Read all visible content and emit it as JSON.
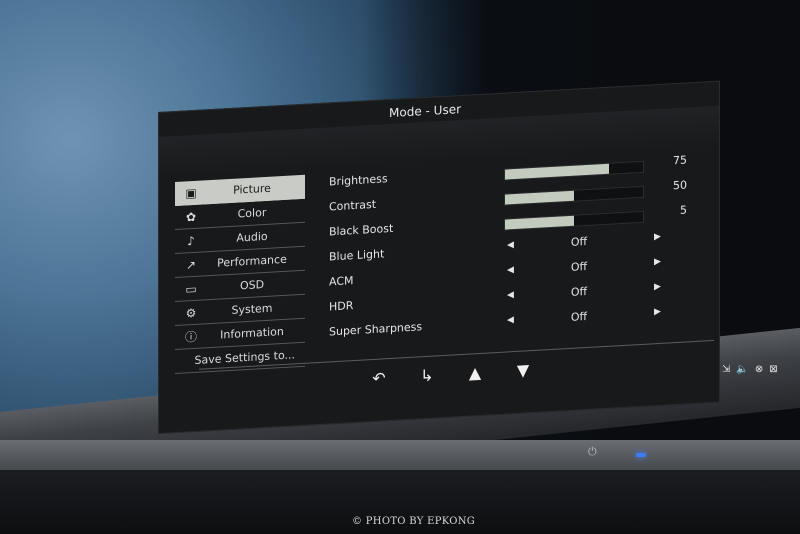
{
  "osd": {
    "title": "Mode - User",
    "menu": [
      {
        "label": "Picture",
        "icon": "picture-icon",
        "glyph": "▣",
        "active": true
      },
      {
        "label": "Color",
        "icon": "palette-icon",
        "glyph": "✿",
        "active": false
      },
      {
        "label": "Audio",
        "icon": "speaker-icon",
        "glyph": "♪",
        "active": false
      },
      {
        "label": "Performance",
        "icon": "performance-icon",
        "glyph": "↗",
        "active": false
      },
      {
        "label": "OSD",
        "icon": "osd-icon",
        "glyph": "▭",
        "active": false
      },
      {
        "label": "System",
        "icon": "gear-icon",
        "glyph": "⚙",
        "active": false
      },
      {
        "label": "Information",
        "icon": "info-icon",
        "glyph": "ⓘ",
        "active": false
      },
      {
        "label": "Save Settings to...",
        "icon": "",
        "glyph": "",
        "active": false
      }
    ],
    "settings": {
      "brightness": {
        "label": "Brightness",
        "value": "75",
        "level": 0.75
      },
      "contrast": {
        "label": "Contrast",
        "value": "50",
        "level": 0.5
      },
      "black_boost": {
        "label": "Black Boost",
        "value": "5",
        "level": 0.5
      },
      "blue_light": {
        "label": "Blue Light",
        "value": "Off"
      },
      "acm": {
        "label": "ACM",
        "value": "Off"
      },
      "hdr": {
        "label": "HDR",
        "value": "Off"
      },
      "super_sharpness": {
        "label": "Super Sharpness",
        "value": "Off"
      }
    },
    "nav": {
      "back": "↶",
      "enter": "↳",
      "up": "▲",
      "down": "▼"
    }
  },
  "tray": {
    "items": [
      "⇲",
      "🔈",
      "⊗",
      "⊠"
    ]
  },
  "credit": "© PHOTO BY EPKONG",
  "colors": {
    "accent": "#c9ccc6",
    "led": "#3b7cff",
    "panel": "#18191b"
  }
}
